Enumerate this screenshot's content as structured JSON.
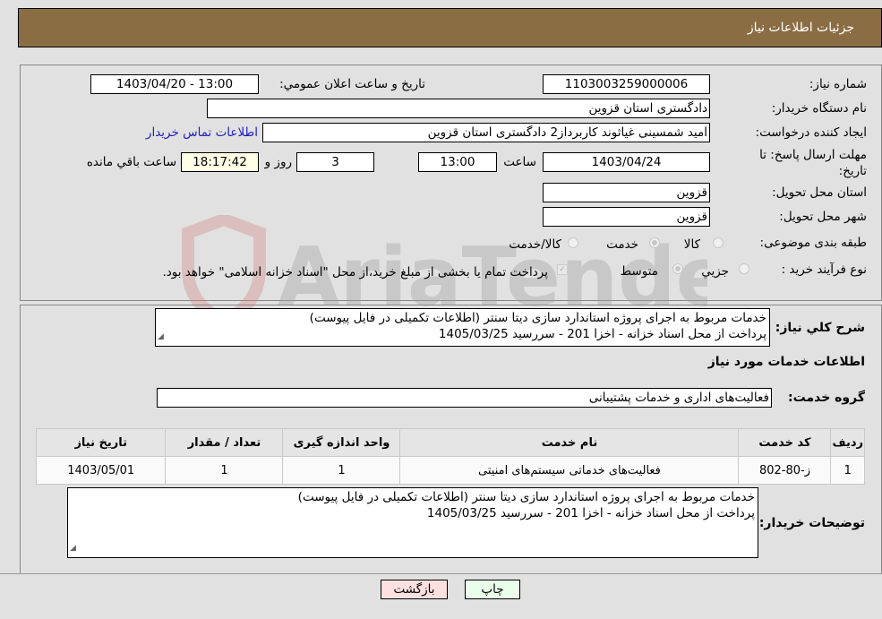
{
  "header": {
    "title": "جزئیات اطلاعات نیاز"
  },
  "form": {
    "need_number": {
      "label": "شماره نیاز:",
      "value": "1103003259000006"
    },
    "announce_datetime": {
      "label": "تاریخ و ساعت اعلان عمومي:",
      "value": "1403/04/20 - 13:00"
    },
    "buyer_org": {
      "label": "نام دستگاه خريدار:",
      "value": "دادگستری استان قزوین"
    },
    "requester": {
      "label": "ایجاد کننده درخواست:",
      "value": "امید شمسینی غیاثوند کاربرداز2 دادگستری استان قزوین"
    },
    "contact_link": "اطلاعات تماس خریدار",
    "deadline": {
      "label_line1": "مهلت ارسال پاسخ: تا",
      "label_line2": "تاریخ:",
      "date": "1403/04/24",
      "time_label": "ساعت",
      "time": "13:00",
      "days": "3",
      "days_label": "روز و",
      "remaining": "18:17:42",
      "remaining_label": "ساعت باقي مانده"
    },
    "province": {
      "label": "استان محل تحویل:",
      "value": "قزوین"
    },
    "city": {
      "label": "شهر محل تحویل:",
      "value": "قزوین"
    },
    "category": {
      "label": "طبقه بندی موضوعی:",
      "options": [
        {
          "label": "کالا",
          "selected": false
        },
        {
          "label": "خدمت",
          "selected": true
        },
        {
          "label": "کالا/خدمت",
          "selected": false
        }
      ]
    },
    "purchase_type": {
      "label": "نوع فرآیند خرید :",
      "options": [
        {
          "label": "جزیي",
          "selected": false
        },
        {
          "label": "متوسط",
          "selected": true
        }
      ],
      "treasury_note": "پرداخت تمام یا بخشی از مبلغ خرید،از محل \"اسناد خزانه اسلامی\" خواهد بود."
    }
  },
  "description": {
    "label": "شرح کلي نياز:",
    "line1": "خدمات مربوط به اجرای پروژه استاندارد سازی دیتا سنتر (اطلاعات تکمیلی در فایل پیوست)",
    "line2": "پرداخت از محل اسناد خزانه - اخزا 201 - سررسید 1405/03/25"
  },
  "services_section": {
    "title": "اطلاعات خدمات مورد نیاز",
    "group_label": "گروه خدمت:",
    "group_value": "فعالیت‌های اداری و خدمات پشتیبانی"
  },
  "table": {
    "headers": [
      "ردیف",
      "کد خدمت",
      "نام خدمت",
      "واحد اندازه گیری",
      "تعداد / مقدار",
      "تاریخ نیاز"
    ],
    "rows": [
      [
        "1",
        "ز-80-802",
        "فعالیت‌های خدماتی سیستم‌های امنیتی",
        "1",
        "1",
        "1403/05/01"
      ]
    ]
  },
  "buyer_notes": {
    "label": "توضیحات خریدار:",
    "line1": "خدمات مربوط به اجرای پروژه استاندارد سازی دیتا سنتر (اطلاعات تکمیلی در فایل پیوست)",
    "line2": "پرداخت از محل اسناد خزانه - اخزا 201 - سررسید 1405/03/25"
  },
  "buttons": {
    "print": "چاپ",
    "back": "بازگشت"
  },
  "watermark": "AriaTender.neT",
  "colors": {
    "header_bg": "#8b6d43",
    "print_bg": "#eaffea",
    "back_bg": "#ffe0e0",
    "link": "#2020c0"
  }
}
